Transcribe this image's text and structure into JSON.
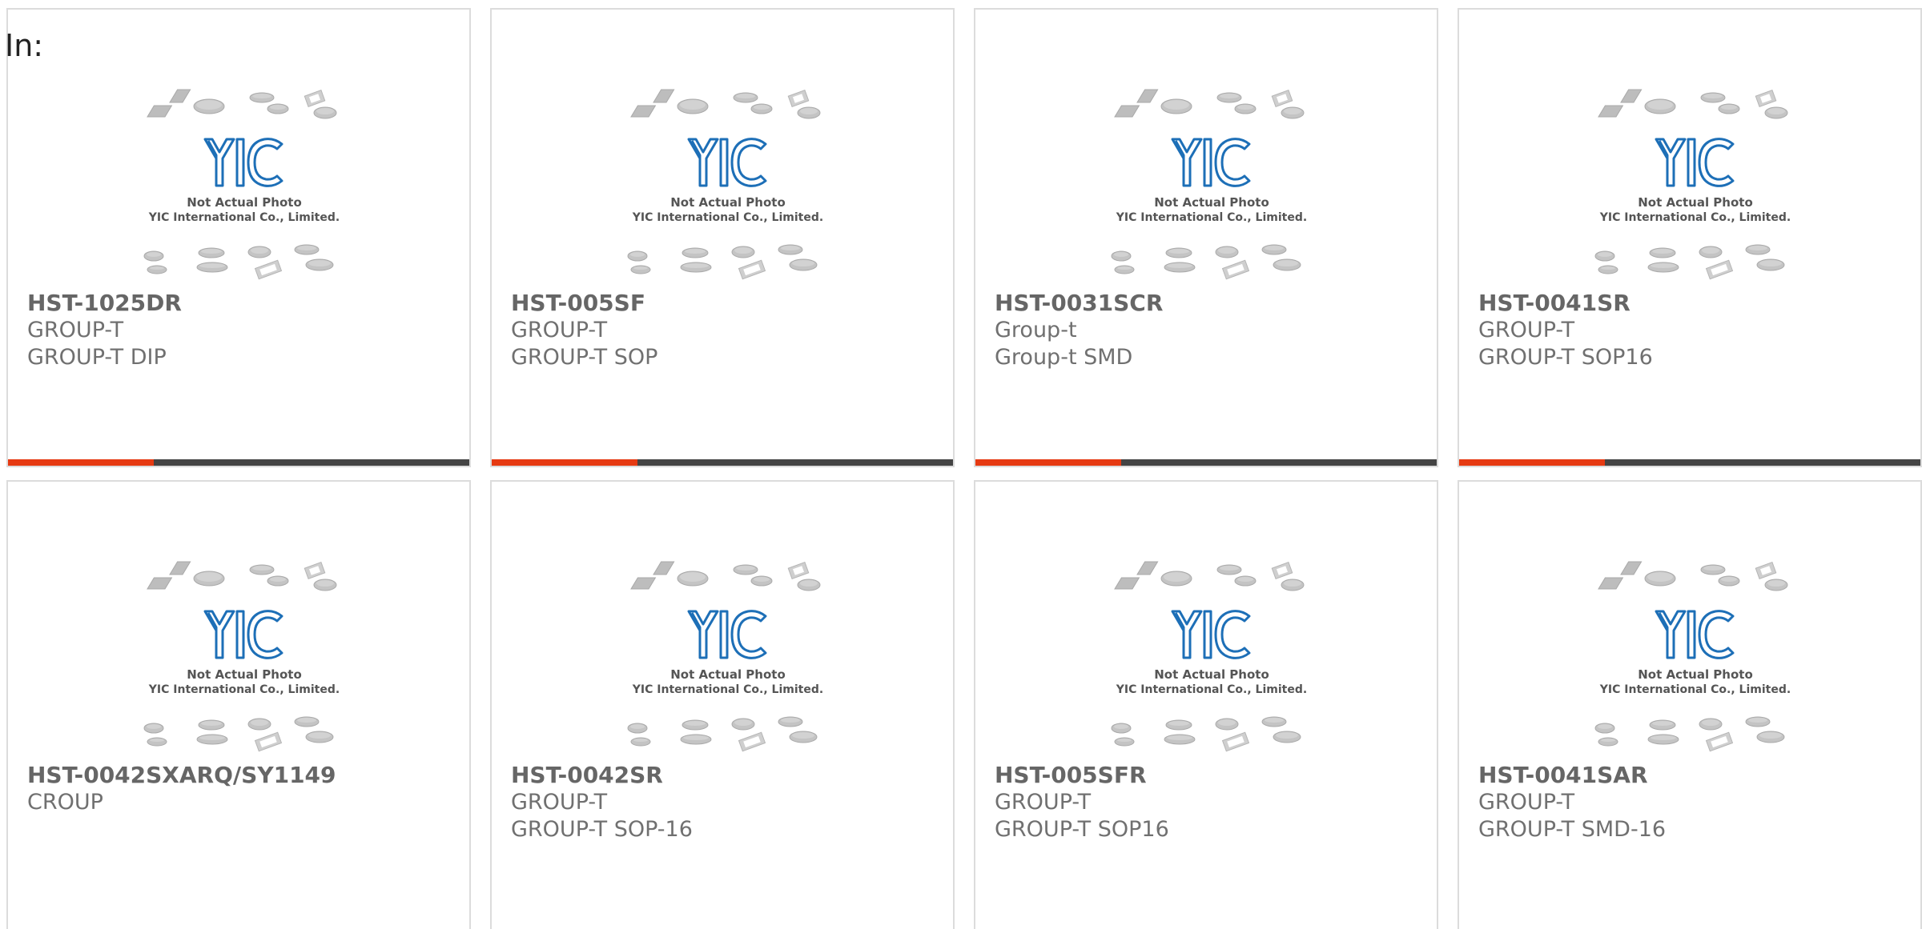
{
  "header": {
    "label": "In:"
  },
  "colors": {
    "accent": "#e63a12",
    "bar": "#444444",
    "logo": "#1d6fb7"
  },
  "photo": {
    "caption_line1": "Not Actual Photo",
    "caption_line2": "YIC International Co., Limited.",
    "logo_text": "YIC"
  },
  "products": [
    {
      "part_number": "HST-1025DR",
      "manufacturer": "GROUP-T",
      "description": "GROUP-T DIP"
    },
    {
      "part_number": "HST-005SF",
      "manufacturer": "GROUP-T",
      "description": "GROUP-T SOP"
    },
    {
      "part_number": "HST-0031SCR",
      "manufacturer": "Group-t",
      "description": "Group-t SMD"
    },
    {
      "part_number": "HST-0041SR",
      "manufacturer": "GROUP-T",
      "description": "GROUP-T SOP16"
    },
    {
      "part_number": "HST-0042SXARQ/SY1149",
      "manufacturer": "CROUP",
      "description": ""
    },
    {
      "part_number": "HST-0042SR",
      "manufacturer": "GROUP-T",
      "description": "GROUP-T SOP-16"
    },
    {
      "part_number": "HST-005SFR",
      "manufacturer": "GROUP-T",
      "description": "GROUP-T SOP16"
    },
    {
      "part_number": "HST-0041SAR",
      "manufacturer": "GROUP-T",
      "description": "GROUP-T SMD-16"
    }
  ]
}
